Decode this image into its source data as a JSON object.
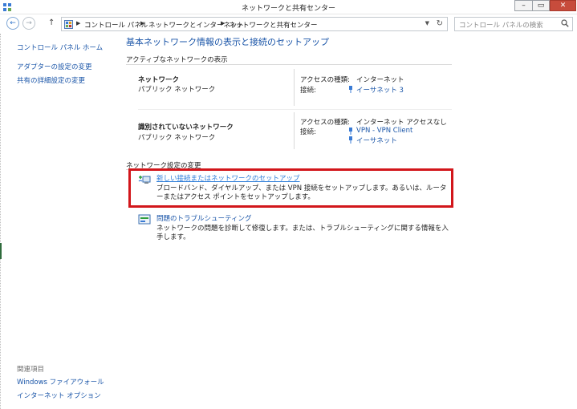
{
  "window": {
    "title": "ネットワークと共有センター"
  },
  "controls": {
    "minimize": "–",
    "maximize": "▭",
    "close": "✕"
  },
  "nav": {
    "back": "←",
    "forward": "→",
    "up": "↑"
  },
  "breadcrumb": [
    "コントロール パネル",
    "ネットワークとインターネット",
    "ネットワークと共有センター"
  ],
  "search": {
    "placeholder": "コントロール パネルの検索"
  },
  "sidebar": {
    "home": "コントロール パネル ホーム",
    "links": [
      "アダプターの設定の変更",
      "共有の詳細設定の変更"
    ],
    "related_heading": "関連項目",
    "related": [
      "Windows ファイアウォール",
      "インターネット オプション"
    ]
  },
  "main": {
    "title": "基本ネットワーク情報の表示と接続のセットアップ",
    "active_header": "アクティブなネットワークの表示",
    "networks": [
      {
        "name": "ネットワーク",
        "type": "パブリック ネットワーク",
        "access_label": "アクセスの種類:",
        "access_value": "インターネット",
        "conn_label": "接続:",
        "connections": [
          "イーサネット 3"
        ]
      },
      {
        "name": "識別されていないネットワーク",
        "type": "パブリック ネットワーク",
        "access_label": "アクセスの種類:",
        "access_value": "インターネット アクセスなし",
        "conn_label": "接続:",
        "connections": [
          "VPN - VPN Client",
          "イーサネット"
        ]
      }
    ],
    "settings_header": "ネットワーク設定の変更",
    "tasks": [
      {
        "link": "新しい接続またはネットワークのセットアップ",
        "desc": "ブロードバンド、ダイヤルアップ、または VPN 接続をセットアップします。あるいは、ルーターまたはアクセス ポイントをセットアップします。",
        "icon": "network-setup-icon",
        "highlighted": true
      },
      {
        "link": "問題のトラブルシューティング",
        "desc": "ネットワークの問題を診断して修復します。または、トラブルシューティングに関する情報を入手します。",
        "icon": "troubleshoot-icon",
        "highlighted": false
      }
    ]
  },
  "colors": {
    "link": "#1a55a8",
    "highlight_border": "#d2161b",
    "close_button": "#c74c3c"
  }
}
